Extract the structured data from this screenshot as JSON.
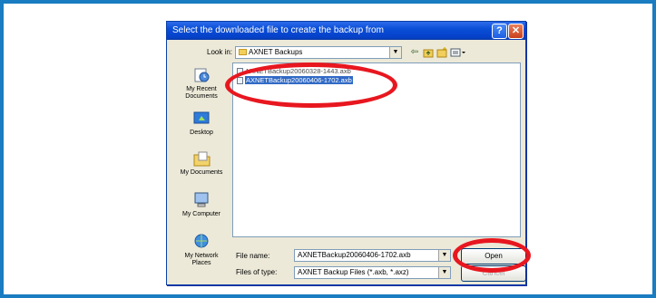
{
  "dialog": {
    "title": "Select the downloaded file to create the backup from",
    "help_glyph": "?",
    "close_glyph": "✕"
  },
  "lookin": {
    "label": "Look in:",
    "value": "AXNET Backups"
  },
  "toolbar_icons": [
    "back-icon",
    "up-folder-icon",
    "new-folder-icon",
    "views-menu-icon"
  ],
  "places": [
    {
      "label": "My Recent Documents",
      "icon": "recent-documents-icon"
    },
    {
      "label": "Desktop",
      "icon": "desktop-icon"
    },
    {
      "label": "My Documents",
      "icon": "my-documents-icon"
    },
    {
      "label": "My Computer",
      "icon": "my-computer-icon"
    },
    {
      "label": "My Network Places",
      "icon": "network-places-icon"
    }
  ],
  "files": [
    {
      "name": "AXNETBackup20060328-1443.axb",
      "selected": false
    },
    {
      "name": "AXNETBackup20060406-1702.axb",
      "selected": true
    }
  ],
  "filename": {
    "label": "File name:",
    "value": "AXNETBackup20060406-1702.axb"
  },
  "filetype": {
    "label": "Files of type:",
    "value": "AXNET Backup Files (*.axb, *.axz)"
  },
  "buttons": {
    "open": "Open",
    "cancel": "Cancel"
  },
  "colors": {
    "border": "#1a7cc1",
    "highlight_ring": "#e8171f",
    "selection": "#316ac5"
  }
}
